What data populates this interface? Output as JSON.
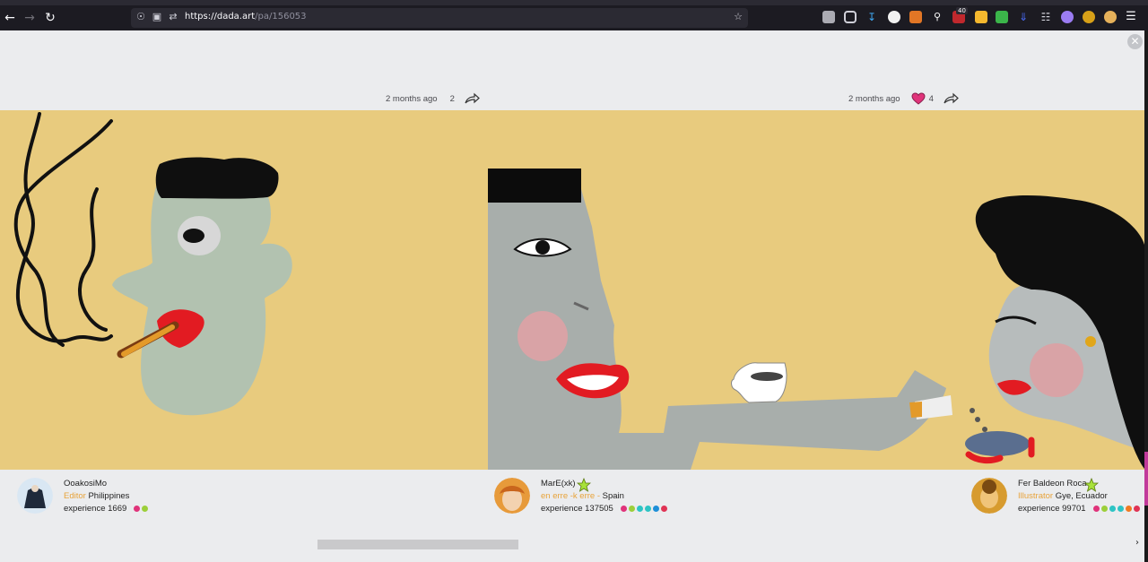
{
  "browser": {
    "url_host": "https://dada.art",
    "url_path": "/pa/156053",
    "extension_badge": "40"
  },
  "posts": [
    {
      "time": "2 months ago",
      "count": "2",
      "liked": false
    },
    {
      "time": "2 months ago",
      "count": "4",
      "liked": true
    }
  ],
  "authors": [
    {
      "name": "OoakosiMo",
      "role": "Editor",
      "location": "Philippines",
      "experience_label": "experience",
      "experience": "1669",
      "star": false,
      "dot_colors": [
        "#e0337a",
        "#9ccf3a"
      ]
    },
    {
      "name": "MarE(xk)",
      "role": "en erre -k erre -",
      "location": "Spain",
      "experience_label": "experience",
      "experience": "137505",
      "star": true,
      "dot_colors": [
        "#e0337a",
        "#9ccf3a",
        "#2ec4c4",
        "#2ec4c4",
        "#1e8fd8",
        "#e03354"
      ]
    },
    {
      "name": "Fer Baldeon Roca",
      "role": "Illustrator",
      "location": "Gye, Ecuador",
      "experience_label": "experience",
      "experience": "99701",
      "star": true,
      "dot_colors": [
        "#e0337a",
        "#9ccf3a",
        "#2ec4c4",
        "#2ec4c4",
        "#f07a22",
        "#e03354"
      ]
    }
  ],
  "colors": {
    "artwork_bg": "#e8cb7e",
    "role_orange": "#e8a33a",
    "star_green": "#a8e23a",
    "heart_pink": "#e0337a"
  }
}
